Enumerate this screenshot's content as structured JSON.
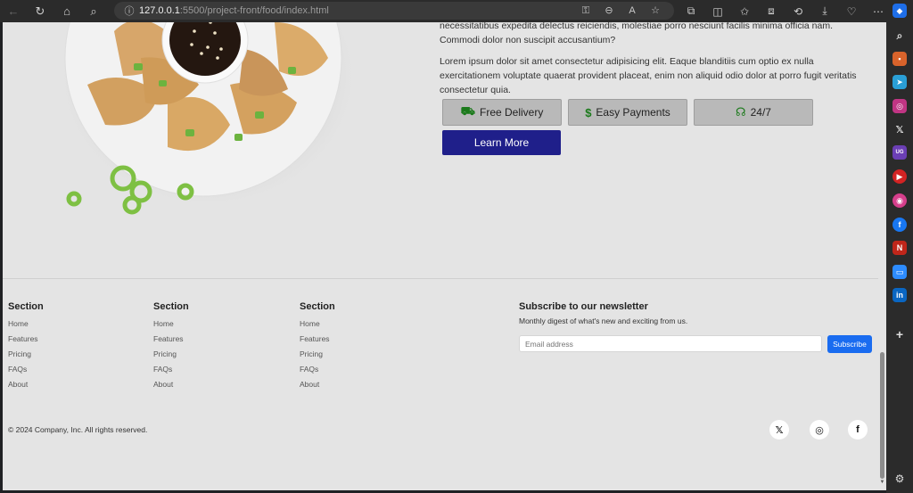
{
  "browser": {
    "url_host": "127.0.0.1",
    "url_path": ":5500/project-front/food/index.html"
  },
  "content": {
    "paragraph1": "necessitatibus expedita delectus reiciendis, molestiae porro nesciunt facilis minima officia nam. Commodi dolor non suscipit accusantium?",
    "paragraph2": "Lorem ipsum dolor sit amet consectetur adipisicing elit. Eaque blanditiis cum optio ex nulla exercitationem voluptate quaerat provident placeat, enim non aliquid odio dolor at porro fugit veritatis consectetur quia.",
    "features": [
      {
        "label": "Free Delivery",
        "icon": "truck-icon"
      },
      {
        "label": "Easy Payments",
        "icon": "dollar-icon"
      },
      {
        "label": "24/7",
        "icon": "headset-icon"
      }
    ],
    "learn_more": "Learn More"
  },
  "footer": {
    "columns": [
      {
        "title": "Section",
        "links": [
          "Home",
          "Features",
          "Pricing",
          "FAQs",
          "About"
        ]
      },
      {
        "title": "Section",
        "links": [
          "Home",
          "Features",
          "Pricing",
          "FAQs",
          "About"
        ]
      },
      {
        "title": "Section",
        "links": [
          "Home",
          "Features",
          "Pricing",
          "FAQs",
          "About"
        ]
      }
    ],
    "newsletter": {
      "title": "Subscribe to our newsletter",
      "subtitle": "Monthly digest of what's new and exciting from us.",
      "email_placeholder": "Email address",
      "subscribe": "Subscribe"
    },
    "copyright": "© 2024 Company, Inc. All rights reserved.",
    "social": [
      "x-icon",
      "instagram-icon",
      "facebook-icon"
    ]
  },
  "colors": {
    "learn_more_bg": "#1f1f8a",
    "subscribe_bg": "#1a6cf0",
    "feature_icon": "#1b7a1b"
  }
}
